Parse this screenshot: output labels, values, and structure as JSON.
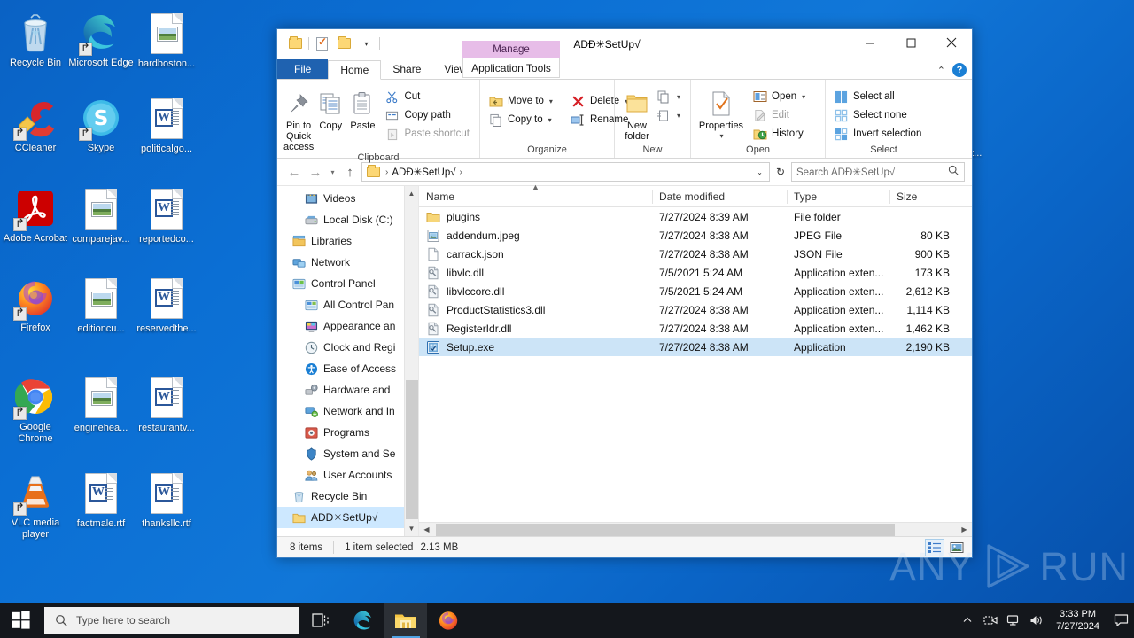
{
  "desktop": {
    "icons": [
      {
        "label": "Recycle Bin",
        "glyph": "recycle-bin",
        "shortcut": false
      },
      {
        "label": "Microsoft Edge",
        "glyph": "edge",
        "shortcut": true
      },
      {
        "label": "hardboston...",
        "glyph": "image-doc",
        "shortcut": false
      },
      {
        "label": "CCleaner",
        "glyph": "ccleaner",
        "shortcut": true
      },
      {
        "label": "Skype",
        "glyph": "skype",
        "shortcut": true
      },
      {
        "label": "politicalgo...",
        "glyph": "word-doc",
        "shortcut": false
      },
      {
        "label": "Adobe Acrobat",
        "glyph": "acrobat",
        "shortcut": true
      },
      {
        "label": "comparejav...",
        "glyph": "image-doc",
        "shortcut": false
      },
      {
        "label": "reportedco...",
        "glyph": "word-doc",
        "shortcut": false
      },
      {
        "label": "Firefox",
        "glyph": "firefox",
        "shortcut": true
      },
      {
        "label": "editioncu...",
        "glyph": "image-doc",
        "shortcut": false
      },
      {
        "label": "reservedthe...",
        "glyph": "word-doc",
        "shortcut": false
      },
      {
        "label": "Google Chrome",
        "glyph": "chrome",
        "shortcut": true
      },
      {
        "label": "enginehea...",
        "glyph": "image-doc",
        "shortcut": false
      },
      {
        "label": "restaurantv...",
        "glyph": "word-doc",
        "shortcut": false
      },
      {
        "label": "VLC media player",
        "glyph": "vlc",
        "shortcut": true
      },
      {
        "label": "factmale.rtf",
        "glyph": "word-doc",
        "shortcut": false
      },
      {
        "label": "thanksllc.rtf",
        "glyph": "word-doc",
        "shortcut": false
      }
    ],
    "occluded_icon_label": "et..."
  },
  "window": {
    "title": "ADÐ✳SetUp√",
    "quick_access": {
      "folder_label": "folder-icon",
      "properties_label": "properties-icon",
      "new_folder_label": "new-folder-icon",
      "customize_caret": "▾"
    },
    "controls": {
      "minimize": "—",
      "maximize": "▢",
      "close": "✕"
    },
    "tabs": [
      {
        "label": "File",
        "kind": "file"
      },
      {
        "label": "Home",
        "kind": "active"
      },
      {
        "label": "Share",
        "kind": "normal"
      },
      {
        "label": "View",
        "kind": "normal"
      }
    ],
    "contextual_tab": {
      "header": "Manage",
      "label": "Application Tools"
    },
    "ribbon_collapse_caret": "⌃",
    "help_label": "?"
  },
  "ribbon": {
    "groups": [
      {
        "title": "Clipboard",
        "big": [
          {
            "label": "Pin to Quick access",
            "icon": "pin-icon"
          },
          {
            "label": "Copy",
            "icon": "copy-icon"
          },
          {
            "label": "Paste",
            "icon": "paste-icon"
          }
        ],
        "small": [
          {
            "label": "Cut",
            "icon": "scissors-icon",
            "disabled": false
          },
          {
            "label": "Copy path",
            "icon": "copy-path-icon",
            "disabled": false
          },
          {
            "label": "Paste shortcut",
            "icon": "paste-shortcut-icon",
            "disabled": true
          }
        ]
      },
      {
        "title": "Organize",
        "small": [
          {
            "label": "Move to",
            "icon": "move-to-icon",
            "caret": "▾"
          },
          {
            "label": "Copy to",
            "icon": "copy-to-icon",
            "caret": "▾"
          }
        ],
        "small2": [
          {
            "label": "Delete",
            "icon": "delete-icon",
            "caret": "▾"
          },
          {
            "label": "Rename",
            "icon": "rename-icon",
            "caret": ""
          }
        ]
      },
      {
        "title": "New",
        "big": [
          {
            "label": "New folder",
            "icon": "new-folder-icon"
          }
        ],
        "small": [
          {
            "label": "",
            "icon": "new-item-icon",
            "caret": "▾"
          },
          {
            "label": "",
            "icon": "easy-access-icon",
            "caret": "▾"
          }
        ]
      },
      {
        "title": "Open",
        "big": [
          {
            "label": "Properties",
            "icon": "properties-icon",
            "caret": "▾"
          }
        ],
        "small": [
          {
            "label": "Open",
            "icon": "open-icon",
            "caret": "▾",
            "disabled": false
          },
          {
            "label": "Edit",
            "icon": "edit-icon",
            "caret": "",
            "disabled": true
          },
          {
            "label": "History",
            "icon": "history-icon",
            "caret": "",
            "disabled": false
          }
        ]
      },
      {
        "title": "Select",
        "small": [
          {
            "label": "Select all",
            "icon": "select-all-icon"
          },
          {
            "label": "Select none",
            "icon": "select-none-icon"
          },
          {
            "label": "Invert selection",
            "icon": "invert-selection-icon"
          }
        ]
      }
    ]
  },
  "address": {
    "back": "←",
    "forward": "→",
    "recent": "▾",
    "up": "↑",
    "crumb_root": "folder-icon",
    "crumb_path": "ADÐ✳SetUp√",
    "crumb_sep": "›",
    "dropdown_caret": "⌄",
    "refresh": "↻",
    "search_placeholder": "Search ADÐ✳SetUp√",
    "search_value": ""
  },
  "nav_pane": {
    "items": [
      {
        "label": "Videos",
        "icon": "videos-icon",
        "indent": true,
        "selected": false
      },
      {
        "label": "Local Disk (C:)",
        "icon": "disk-icon",
        "indent": true,
        "selected": false
      },
      {
        "label": "Libraries",
        "icon": "libraries-icon",
        "indent": false,
        "selected": false
      },
      {
        "label": "Network",
        "icon": "network-icon",
        "indent": false,
        "selected": false
      },
      {
        "label": "Control Panel",
        "icon": "control-panel-icon",
        "indent": false,
        "selected": false
      },
      {
        "label": "All Control Pan",
        "icon": "all-control-panel-icon",
        "indent": true,
        "selected": false
      },
      {
        "label": "Appearance an",
        "icon": "appearance-icon",
        "indent": true,
        "selected": false
      },
      {
        "label": "Clock and Regi",
        "icon": "clock-region-icon",
        "indent": true,
        "selected": false
      },
      {
        "label": "Ease of Access",
        "icon": "ease-of-access-icon",
        "indent": true,
        "selected": false
      },
      {
        "label": "Hardware and",
        "icon": "hardware-icon",
        "indent": true,
        "selected": false
      },
      {
        "label": "Network and In",
        "icon": "network-internet-icon",
        "indent": true,
        "selected": false
      },
      {
        "label": "Programs",
        "icon": "programs-icon",
        "indent": true,
        "selected": false
      },
      {
        "label": "System and Se",
        "icon": "system-security-icon",
        "indent": true,
        "selected": false
      },
      {
        "label": "User Accounts",
        "icon": "user-accounts-icon",
        "indent": true,
        "selected": false
      },
      {
        "label": "Recycle Bin",
        "icon": "recycle-bin-icon",
        "indent": false,
        "selected": false
      },
      {
        "label": "ADÐ✳SetUp√",
        "icon": "folder-icon",
        "indent": false,
        "selected": true
      }
    ]
  },
  "file_list": {
    "columns": [
      {
        "label": "Name",
        "sorted": "asc"
      },
      {
        "label": "Date modified",
        "sorted": ""
      },
      {
        "label": "Type",
        "sorted": ""
      },
      {
        "label": "Size",
        "sorted": ""
      }
    ],
    "rows": [
      {
        "name": "plugins",
        "date": "7/27/2024 8:39 AM",
        "type": "File folder",
        "size": "",
        "icon": "folder-icon",
        "selected": false
      },
      {
        "name": "addendum.jpeg",
        "date": "7/27/2024 8:38 AM",
        "type": "JPEG File",
        "size": "80 KB",
        "icon": "jpeg-icon",
        "selected": false
      },
      {
        "name": "carrack.json",
        "date": "7/27/2024 8:38 AM",
        "type": "JSON File",
        "size": "900 KB",
        "icon": "generic-file-icon",
        "selected": false
      },
      {
        "name": "libvlc.dll",
        "date": "7/5/2021 5:24 AM",
        "type": "Application exten...",
        "size": "173 KB",
        "icon": "dll-icon",
        "selected": false
      },
      {
        "name": "libvlccore.dll",
        "date": "7/5/2021 5:24 AM",
        "type": "Application exten...",
        "size": "2,612 KB",
        "icon": "dll-icon",
        "selected": false
      },
      {
        "name": "ProductStatistics3.dll",
        "date": "7/27/2024 8:38 AM",
        "type": "Application exten...",
        "size": "1,114 KB",
        "icon": "dll-icon",
        "selected": false
      },
      {
        "name": "RegisterIdr.dll",
        "date": "7/27/2024 8:38 AM",
        "type": "Application exten...",
        "size": "1,462 KB",
        "icon": "dll-icon",
        "selected": false
      },
      {
        "name": "Setup.exe",
        "date": "7/27/2024 8:38 AM",
        "type": "Application",
        "size": "2,190 KB",
        "icon": "exe-icon",
        "selected": true
      }
    ]
  },
  "status_bar": {
    "item_count": "8 items",
    "selection": "1 item selected",
    "selection_size": "2.13 MB",
    "details_view": "details-view-icon",
    "large_icons_view": "large-icons-view-icon"
  },
  "watermark": {
    "left": "ANY",
    "right": "RUN"
  },
  "taskbar": {
    "start": "start-icon",
    "search_placeholder": "Type here to search",
    "buttons": [
      {
        "name": "task-view-icon"
      },
      {
        "name": "edge-icon"
      },
      {
        "name": "file-explorer-icon",
        "active": true
      },
      {
        "name": "firefox-icon"
      }
    ],
    "tray": [
      {
        "name": "show-hidden-icons",
        "glyph": "⌃"
      },
      {
        "name": "meet-now-icon",
        "glyph": ""
      },
      {
        "name": "network-icon",
        "glyph": ""
      },
      {
        "name": "volume-icon",
        "glyph": ""
      }
    ],
    "time": "3:33 PM",
    "date": "7/27/2024",
    "action_center": "notification-icon"
  },
  "colors": {
    "accent": "#0a62c4",
    "selection": "#cce4f7",
    "nav_selection": "#cde8ff",
    "file_tab": "#1f62b0",
    "contextual": "#e7bde8",
    "taskbar": "#14171c"
  }
}
